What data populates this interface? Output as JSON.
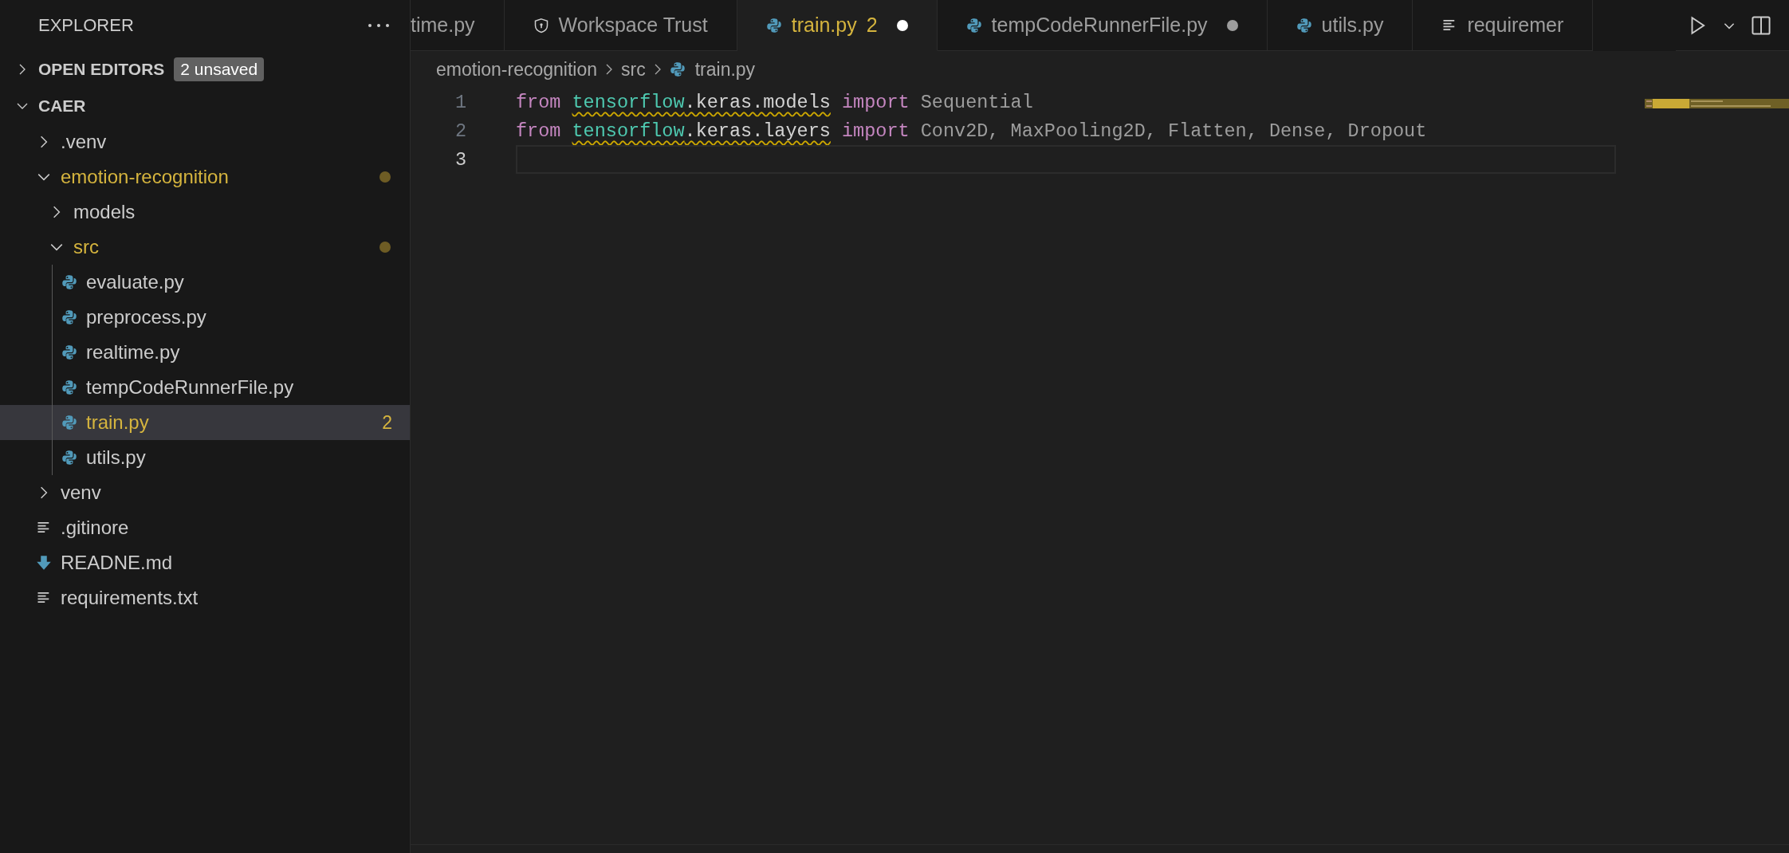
{
  "sidebar": {
    "title": "EXPLORER",
    "open_editors": {
      "label": "OPEN EDITORS",
      "expanded": false,
      "badge": "2 unsaved"
    },
    "workspace": {
      "label": "CAER",
      "expanded": true,
      "children": [
        {
          "label": ".venv",
          "kind": "folder",
          "expanded": false,
          "selected": false,
          "modified": false,
          "warning": false
        },
        {
          "label": "emotion-recognition",
          "kind": "folder",
          "expanded": true,
          "selected": false,
          "modified": true,
          "warning": false,
          "children": [
            {
              "label": "models",
              "kind": "folder",
              "expanded": false,
              "selected": false,
              "modified": false,
              "warning": false
            },
            {
              "label": "src",
              "kind": "folder",
              "expanded": true,
              "selected": false,
              "modified": true,
              "warning": false,
              "children": [
                {
                  "label": "evaluate.py",
                  "kind": "python",
                  "selected": false,
                  "modified": false,
                  "warning": false
                },
                {
                  "label": "preprocess.py",
                  "kind": "python",
                  "selected": false,
                  "modified": false,
                  "warning": false
                },
                {
                  "label": "realtime.py",
                  "kind": "python",
                  "selected": false,
                  "modified": false,
                  "warning": false
                },
                {
                  "label": "tempCodeRunnerFile.py",
                  "kind": "python",
                  "selected": false,
                  "modified": false,
                  "warning": false
                },
                {
                  "label": "train.py",
                  "kind": "python",
                  "selected": true,
                  "modified": false,
                  "warning": true,
                  "badge": "2"
                },
                {
                  "label": "utils.py",
                  "kind": "python",
                  "selected": false,
                  "modified": false,
                  "warning": false
                }
              ]
            }
          ]
        },
        {
          "label": "venv",
          "kind": "folder",
          "expanded": false,
          "selected": false,
          "modified": false,
          "warning": false
        },
        {
          "label": ".gitinore",
          "kind": "text",
          "selected": false,
          "modified": false,
          "warning": false
        },
        {
          "label": "READNE.md",
          "kind": "markdown",
          "selected": false,
          "modified": false,
          "warning": false
        },
        {
          "label": "requirements.txt",
          "kind": "text",
          "selected": false,
          "modified": false,
          "warning": false
        }
      ]
    }
  },
  "tabs": [
    {
      "label": "time.py",
      "kind": "clipped",
      "selected": false,
      "dirty": false,
      "warning": false
    },
    {
      "label": "Workspace Trust",
      "kind": "settings",
      "selected": false,
      "dirty": false,
      "warning": false
    },
    {
      "label": "train.py",
      "kind": "python",
      "selected": true,
      "dirty": true,
      "badge": "2",
      "warning": true
    },
    {
      "label": "tempCodeRunnerFile.py",
      "kind": "python",
      "selected": false,
      "dirty": true,
      "warning": false
    },
    {
      "label": "utils.py",
      "kind": "python",
      "selected": false,
      "dirty": false,
      "warning": false
    },
    {
      "label": "requiremer",
      "kind": "text",
      "selected": false,
      "dirty": false,
      "warning": false
    }
  ],
  "breadcrumbs": [
    {
      "label": "emotion-recognition",
      "kind": "folder"
    },
    {
      "label": "src",
      "kind": "folder"
    },
    {
      "label": "train.py",
      "kind": "python"
    }
  ],
  "code": [
    {
      "number": "1",
      "current": false,
      "warning": true,
      "tokens": [
        {
          "text": "from ",
          "kind": "keyword"
        },
        {
          "text": "tensorflow",
          "kind": "module"
        },
        {
          "text": ".keras.models",
          "kind": "path"
        },
        {
          "text": " import ",
          "kind": "keyword"
        },
        {
          "text": "Sequential",
          "kind": "unused"
        }
      ]
    },
    {
      "number": "2",
      "current": false,
      "warning": true,
      "tokens": [
        {
          "text": "from ",
          "kind": "keyword"
        },
        {
          "text": "tensorflow",
          "kind": "module"
        },
        {
          "text": ".keras.layers",
          "kind": "path"
        },
        {
          "text": " import ",
          "kind": "keyword"
        },
        {
          "text": "Conv2D, MaxPooling2D, Flatten, Dense, Dropout",
          "kind": "unused"
        }
      ]
    },
    {
      "number": "3",
      "current": true
    }
  ]
}
